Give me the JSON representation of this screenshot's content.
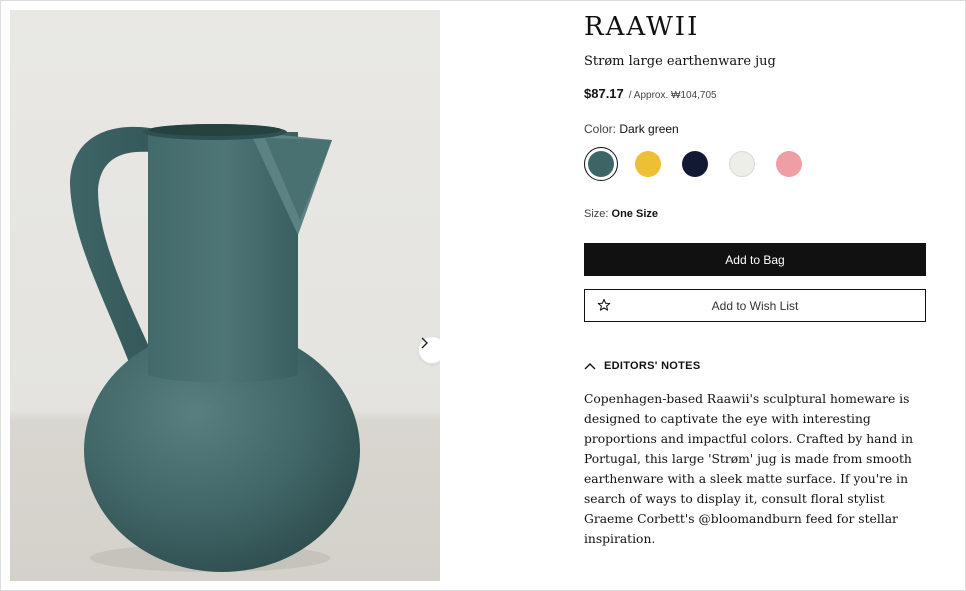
{
  "product": {
    "brand": "RAAWII",
    "name": "Strøm large earthenware jug",
    "price": "$87.17",
    "approx_price": "/ Approx. ₩104,705"
  },
  "color": {
    "label": "Color:",
    "selected": "Dark green",
    "options": [
      {
        "name": "Dark green",
        "hex": "#3d6566",
        "selected": true
      },
      {
        "name": "Yellow",
        "hex": "#edbf35",
        "selected": false
      },
      {
        "name": "Navy",
        "hex": "#121a33",
        "selected": false
      },
      {
        "name": "White",
        "hex": "#eeeee8",
        "selected": false
      },
      {
        "name": "Pink",
        "hex": "#ee9ea5",
        "selected": false
      }
    ]
  },
  "size": {
    "label": "Size:",
    "value": "One Size"
  },
  "actions": {
    "add_to_bag": "Add to Bag",
    "add_to_wishlist": "Add to Wish List"
  },
  "editors_notes": {
    "title": "EDITORS' NOTES",
    "body": "Copenhagen-based Raawii's sculptural homeware is designed to captivate the eye with interesting proportions and impactful colors. Crafted by hand in Portugal, this large 'Strøm' jug is made from smooth earthenware with a sleek matte surface. If you're in search of ways to display it, consult floral stylist Graeme Corbett's @bloomandburn feed for stellar inspiration."
  },
  "icons": {
    "next": "chevron-right-icon",
    "wishlist": "star-icon",
    "notes_toggle": "chevron-up-icon"
  }
}
